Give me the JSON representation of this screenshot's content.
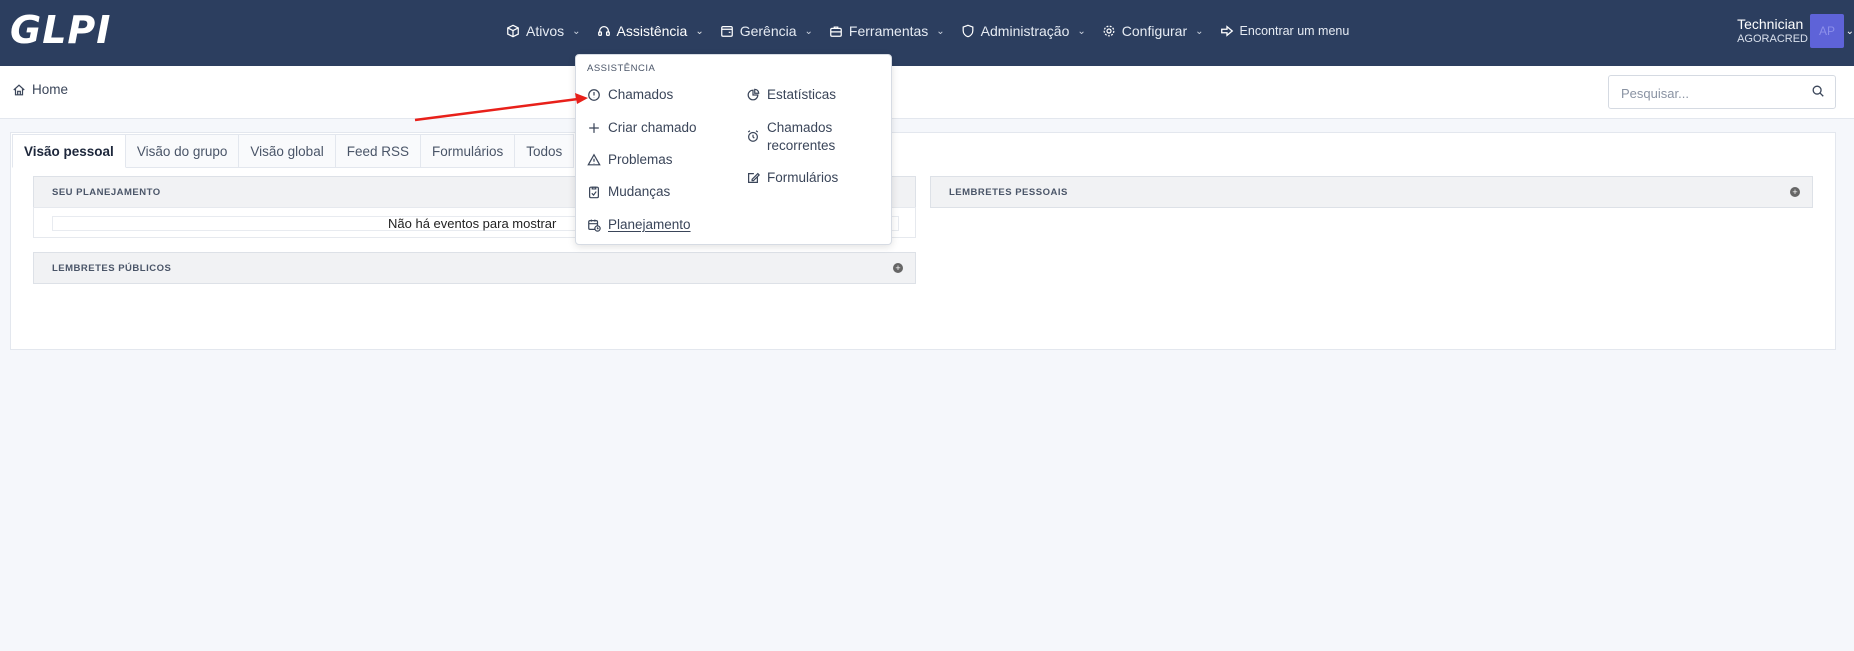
{
  "navbar": {
    "logo_text": "GLPI",
    "menu": [
      {
        "label": "Ativos",
        "icon": "cube-icon"
      },
      {
        "label": "Assistência",
        "icon": "headset-icon"
      },
      {
        "label": "Gerência",
        "icon": "wallet-icon"
      },
      {
        "label": "Ferramentas",
        "icon": "briefcase-icon"
      },
      {
        "label": "Administração",
        "icon": "shield-icon"
      },
      {
        "label": "Configurar",
        "icon": "gear-icon"
      }
    ],
    "find_menu_label": "Encontrar um menu",
    "user": {
      "name": "Technician",
      "entity": "AGORACRED",
      "initials": "AP"
    }
  },
  "breadcrumb": {
    "home_label": "Home"
  },
  "search": {
    "placeholder": "Pesquisar..."
  },
  "tabs": [
    {
      "label": "Visão pessoal",
      "active": true
    },
    {
      "label": "Visão do grupo"
    },
    {
      "label": "Visão global"
    },
    {
      "label": "Feed RSS"
    },
    {
      "label": "Formulários"
    },
    {
      "label": "Todos"
    }
  ],
  "panels": {
    "planning_title": "SEU PLANEJAMENTO",
    "no_events_text": "Não há eventos para mostrar",
    "public_reminders_title": "LEMBRETES PÚBLICOS",
    "personal_reminders_title": "LEMBRETES PESSOAIS"
  },
  "dropdown": {
    "header": "ASSISTÊNCIA",
    "left_items": [
      {
        "label": "Chamados",
        "icon": "alert-circle-icon"
      },
      {
        "label": "Criar chamado",
        "icon": "plus-icon"
      },
      {
        "label": "Problemas",
        "icon": "warning-triangle-icon"
      },
      {
        "label": "Mudanças",
        "icon": "clipboard-check-icon"
      },
      {
        "label": "Planejamento",
        "icon": "calendar-clock-icon"
      }
    ],
    "right_items": [
      {
        "label": "Estatísticas",
        "icon": "pie-chart-icon"
      },
      {
        "label": "Chamados recorrentes",
        "icon": "alarm-clock-icon"
      },
      {
        "label": "Formulários",
        "icon": "edit-icon"
      }
    ]
  },
  "colors": {
    "navbar_bg": "#2c3e5f",
    "avatar_bg": "#5e63d8",
    "annotation_arrow": "#e8201a"
  }
}
